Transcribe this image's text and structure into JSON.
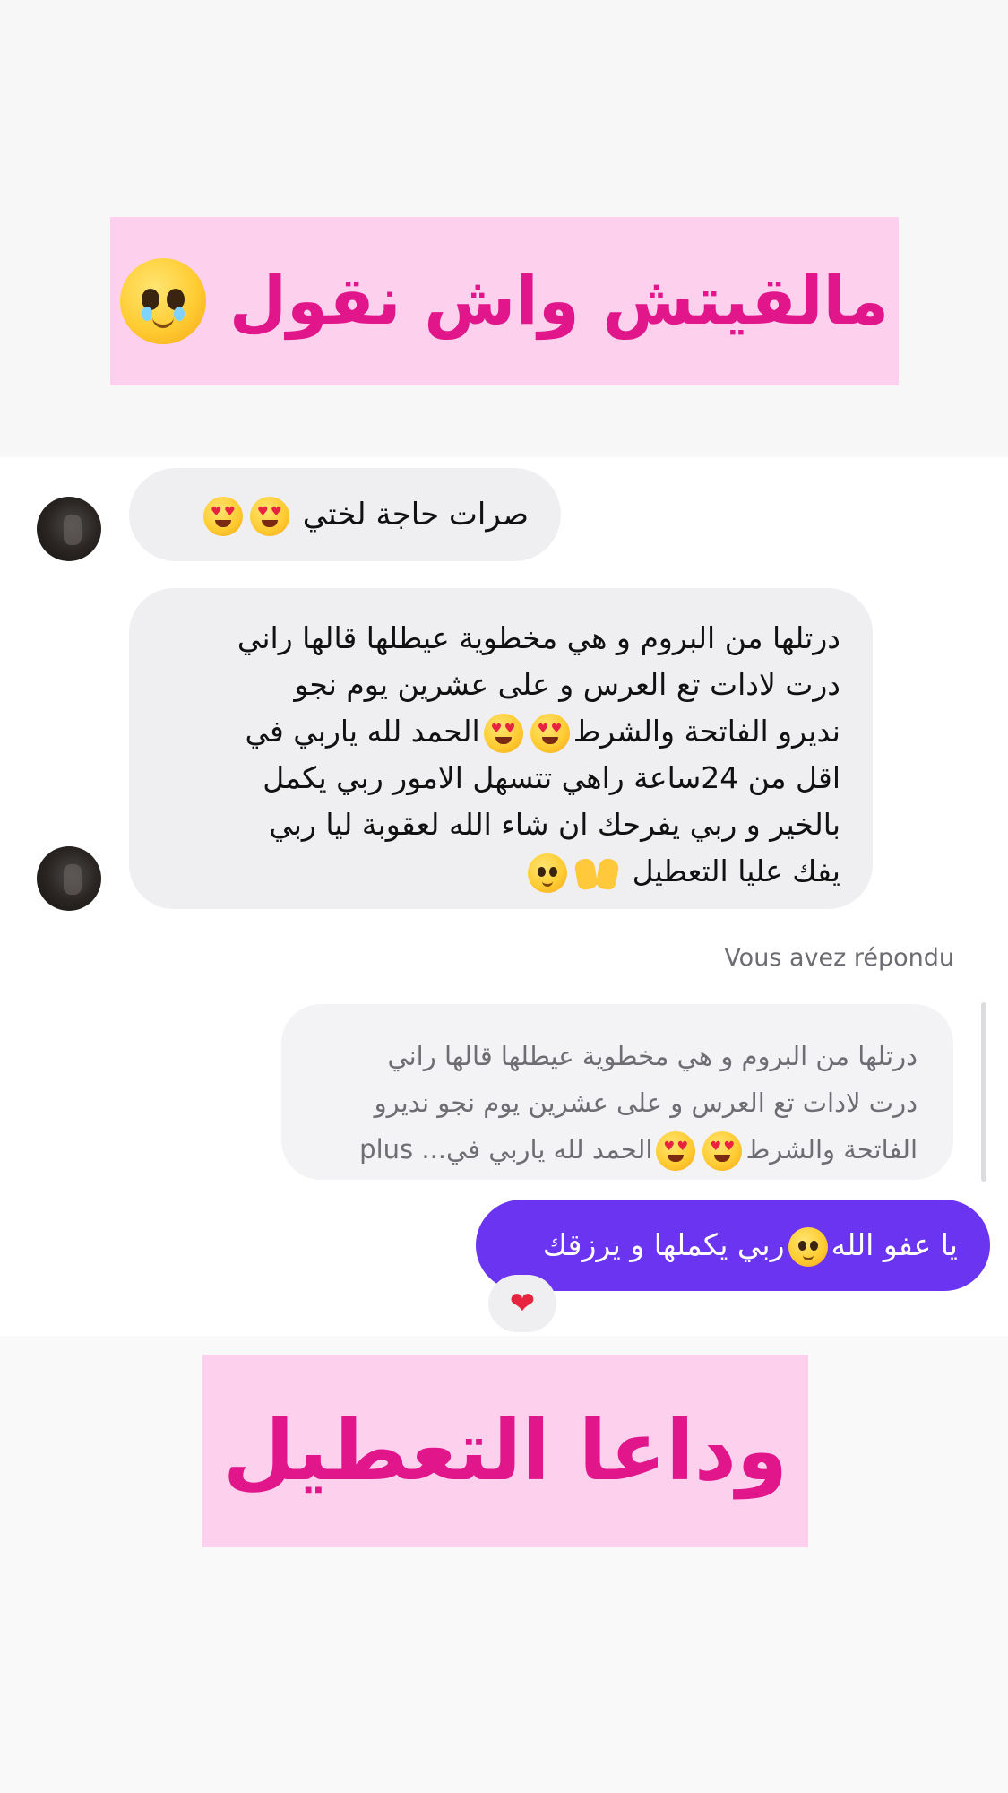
{
  "banners": {
    "top_text": "مالقيتش واش نقول",
    "bottom_text": "وداعا التعطيل"
  },
  "messages": {
    "msg1": {
      "text": "صرات حاجة لختي"
    },
    "msg2": {
      "lines": [
        "درتلها من البروم و هي مخطوية عيطلها قالها راني",
        "درت لادات تع العرس و على عشرين يوم نجو",
        "نديرو الفاتحة والشرط",
        "الحمد لله ياربي في",
        "اقل من 24ساعة راهي تتسهل الامور ربي يكمل",
        "بالخير و ربي يفرحك ان شاء الله لعقوبة ليا ربي",
        "يفك عليا التعطيل"
      ]
    },
    "reply_label": "Vous avez répondu",
    "quote": {
      "line1": "درتلها من البروم و هي مخطوية عيطلها قالها راني",
      "line2": "درت لادات تع العرس و على عشرين يوم نجو نديرو",
      "line3_a": "الفاتحة والشرط",
      "line3_b": "الحمد لله ياربي في...",
      "more": "plus"
    },
    "outgoing": {
      "part_a": "يا عفو الله",
      "part_b": "ربي يكملها و يرزقك"
    },
    "reaction": "❤"
  },
  "colors": {
    "banner_bg": "#fdd0ee",
    "banner_text": "#e0168a",
    "incoming_bubble": "#efeff2",
    "outgoing_bubble": "#6a34f0"
  },
  "icons": [
    "pleading-face-emoji",
    "heart-eyes-emoji",
    "raised-hands-emoji",
    "red-heart-reaction"
  ]
}
